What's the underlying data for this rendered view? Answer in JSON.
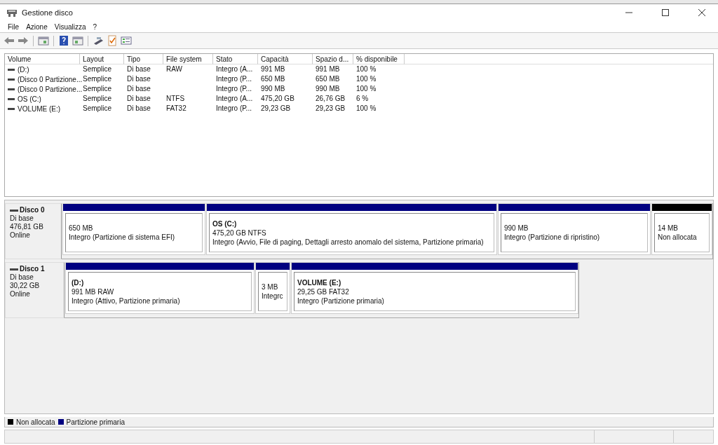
{
  "window": {
    "title": "Gestione disco"
  },
  "menu": [
    "File",
    "Azione",
    "Visualizza",
    "?"
  ],
  "table": {
    "columns": [
      "Volume",
      "Layout",
      "Tipo",
      "File system",
      "Stato",
      "Capacità",
      "Spazio d...",
      "% disponibile"
    ],
    "rows": [
      [
        "(D:)",
        "Semplice",
        "Di base",
        "RAW",
        "Integro (A...",
        "991 MB",
        "991 MB",
        "100 %"
      ],
      [
        "(Disco 0 Partizione...",
        "Semplice",
        "Di base",
        "",
        "Integro (P...",
        "650 MB",
        "650 MB",
        "100 %"
      ],
      [
        "(Disco 0 Partizione...",
        "Semplice",
        "Di base",
        "",
        "Integro (P...",
        "990 MB",
        "990 MB",
        "100 %"
      ],
      [
        "OS (C:)",
        "Semplice",
        "Di base",
        "NTFS",
        "Integro (A...",
        "475,20 GB",
        "26,76 GB",
        "6 %"
      ],
      [
        "VOLUME (E:)",
        "Semplice",
        "Di base",
        "FAT32",
        "Integro (P...",
        "29,23 GB",
        "29,23 GB",
        "100 %"
      ]
    ]
  },
  "disks": [
    {
      "name": "Disco 0",
      "type": "Di base",
      "size": "476,81 GB",
      "status": "Online",
      "partitions": [
        {
          "kind": "primary",
          "size": "650 MB",
          "status": "Integro (Partizione di sistema EFI)"
        },
        {
          "kind": "primary",
          "title": "OS (C:)",
          "size": "475,20 GB NTFS",
          "status": "Integro (Avvio, File di paging, Dettagli arresto anomalo del sistema, Partizione primaria)"
        },
        {
          "kind": "primary",
          "size": "990 MB",
          "status": "Integro (Partizione di ripristino)"
        },
        {
          "kind": "unallocated",
          "size": "14 MB",
          "status": "Non allocata"
        }
      ]
    },
    {
      "name": "Disco 1",
      "type": "Di base",
      "size": "30,22 GB",
      "status": "Online",
      "partitions": [
        {
          "kind": "primary",
          "title": "(D:)",
          "size": "991 MB RAW",
          "status": "Integro (Attivo, Partizione primaria)"
        },
        {
          "kind": "primary",
          "size": "3 MB",
          "status": "Integrc"
        },
        {
          "kind": "primary",
          "title": "VOLUME (E:)",
          "size": "29,25 GB FAT32",
          "status": "Integro (Partizione primaria)"
        }
      ]
    }
  ],
  "legend": [
    {
      "label": "Non allocata",
      "color": "#000000"
    },
    {
      "label": "Partizione primaria",
      "color": "#000080"
    }
  ]
}
